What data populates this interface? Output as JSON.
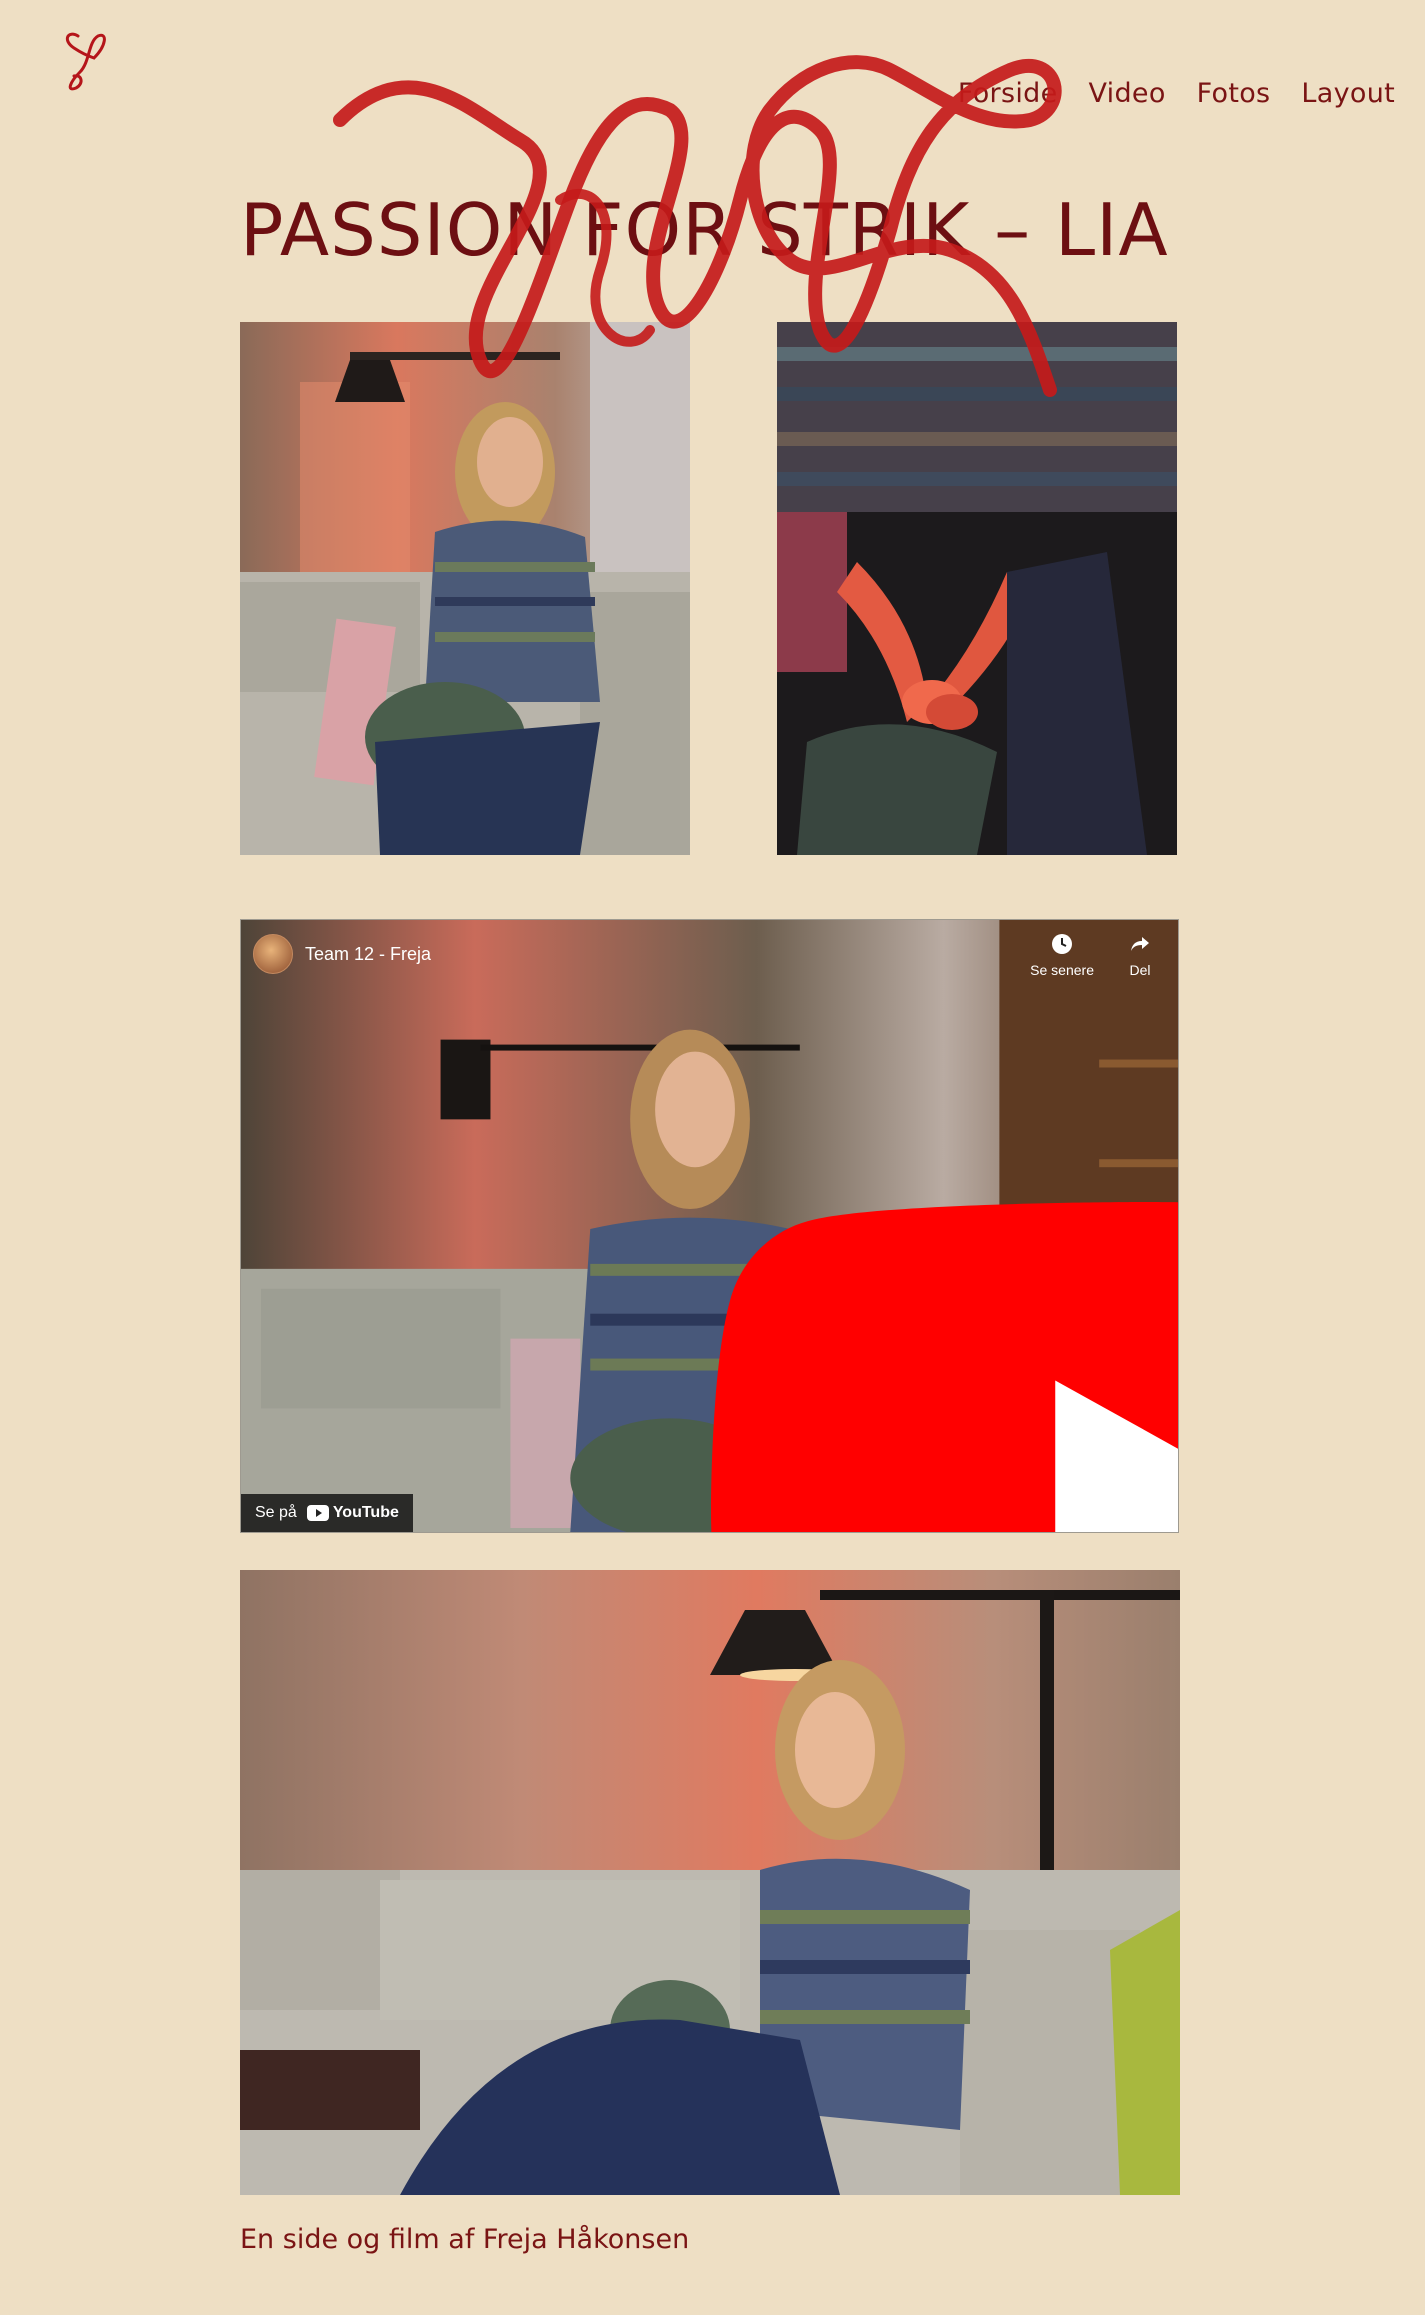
{
  "nav": {
    "items": [
      "Forside",
      "Video",
      "Fotos",
      "Layout"
    ]
  },
  "page": {
    "title": "PASSION FOR STRIK – LIA",
    "footer_text": "En side og film af Freja Håkonsen"
  },
  "video": {
    "channel_name": "Team 12 - Freja",
    "watch_later_label": "Se senere",
    "share_label": "Del",
    "watch_on_label": "Se på",
    "youtube_label": "YouTube"
  },
  "colors": {
    "background": "#eedfc4",
    "accent": "#7a1414",
    "scribble": "#c41a1a"
  }
}
